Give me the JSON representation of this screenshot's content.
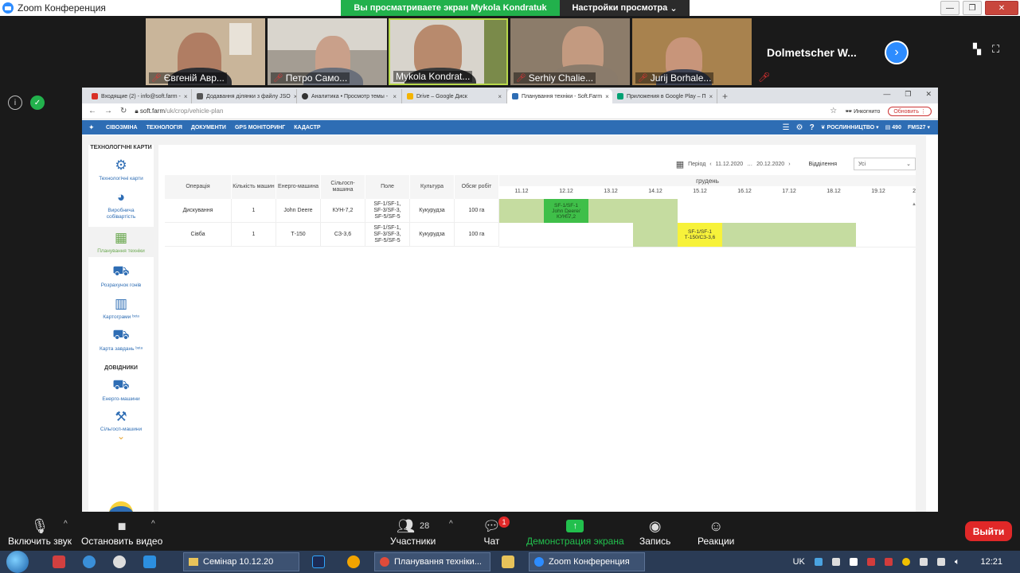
{
  "zoom": {
    "title": "Zoom Конференция",
    "share_banner": "Вы просматриваете экран Mykola Kondratuk",
    "view_options": "Настройки просмотра",
    "participants": [
      {
        "name": "Євгеній Авр..."
      },
      {
        "name": "Петро Само..."
      },
      {
        "name": "Mykola Kondrat..."
      },
      {
        "name": "Serhiy Chalie..."
      },
      {
        "name": "Jurij Borhale..."
      }
    ],
    "extra_participant": "Dolmetscher  W...",
    "toolbar": {
      "unmute": "Включить звук",
      "stop_video": "Остановить видео",
      "participants": "Участники",
      "participants_count": "28",
      "chat": "Чат",
      "chat_badge": "1",
      "share_screen": "Демонстрация экрана",
      "record": "Запись",
      "reactions": "Реакции",
      "leave": "Выйти"
    }
  },
  "browser": {
    "tabs": [
      {
        "title": "Входящие (2) - info@soft.farm -",
        "color": "#d93025"
      },
      {
        "title": "Додавання ділянки з файлу JSO",
        "color": "#555555"
      },
      {
        "title": "Аналитика • Просмотр темы - ",
        "color": "#333333"
      },
      {
        "title": "Drive – Google Диск",
        "color": "#f4b400"
      },
      {
        "title": "Планування техніки - Soft.Farm",
        "color": "#2e6db4"
      },
      {
        "title": "Приложения в Google Play – П",
        "color": "#00a173"
      }
    ],
    "url_domain": "soft.farm",
    "url_path": "/uk/crop/vehicle-plan",
    "incognito": "Инкогнито",
    "update": "Обновить"
  },
  "app": {
    "nav": [
      "СІВОЗМІНА",
      "ТЕХНОЛОГІЯ",
      "ДОКУМЕНТИ",
      "GPS МОНІТОРИНГ",
      "КАДАСТР"
    ],
    "crop_mode": "РОСЛИННИЦТВО",
    "balance": "490",
    "account": "FMS27",
    "sidebar": {
      "heading": "ТЕХНОЛОГІЧНІ КАРТИ",
      "items": [
        {
          "label": "Технологічні карти"
        },
        {
          "label": "Виробнича собівартість"
        },
        {
          "label": "Планування техніки"
        },
        {
          "label": "Розрахунок гонів"
        },
        {
          "label": "Картограми ᵇᵉᵗᵃ"
        },
        {
          "label": "Карта завдань ᵇᵉᵗᵃ"
        }
      ],
      "heading2": "ДОВІДНИКИ",
      "items2": [
        {
          "label": "Енерго-машини"
        },
        {
          "label": "Сільгосп-машини"
        }
      ]
    },
    "period_label": "Період",
    "period_from": "11.12.2020",
    "period_to": "20.12.2020",
    "department_label": "Відділення",
    "department_value": "Усі",
    "columns": [
      "Операція",
      "Кількість машин",
      "Енерго-машина",
      "Сільгосп-машина",
      "Поле",
      "Культура",
      "Обсяг робіт"
    ],
    "month": "грудень",
    "days": [
      "11.12",
      "12.12",
      "13.12",
      "14.12",
      "15.12",
      "16.12",
      "17.12",
      "18.12",
      "19.12",
      "2"
    ],
    "rows": [
      {
        "operation": "Дискування",
        "count": "1",
        "tractor": "John Deere",
        "implement": "КУН-7,2",
        "field": "SF-1/SF-1, SF-3/SF-3, SF-5/SF-5",
        "crop": "Кукурудза",
        "volume": "100 га",
        "chip_line1": "SF-1/SF-1",
        "chip_line2": "John Deere/",
        "chip_line3": "КУН-7,2",
        "chip_color": "#3fbf49"
      },
      {
        "operation": "Сівба",
        "count": "1",
        "tractor": "Т-150",
        "implement": "СЗ-3,6",
        "field": "SF-1/SF-1, SF-3/SF-3, SF-5/SF-5",
        "crop": "Кукурудза",
        "volume": "100 га",
        "chip_line1": "SF-1/SF-1",
        "chip_line2": "Т-150/СЗ-3,6",
        "chip_line3": "",
        "chip_color": "#f7f23a"
      }
    ],
    "plan_bar_color": "#c5dca0"
  },
  "taskbar": {
    "items": [
      "Семінар 10.12.20",
      "Планування техніки...",
      "Zoom Конференция"
    ],
    "lang": "UK",
    "time": "12:21"
  }
}
